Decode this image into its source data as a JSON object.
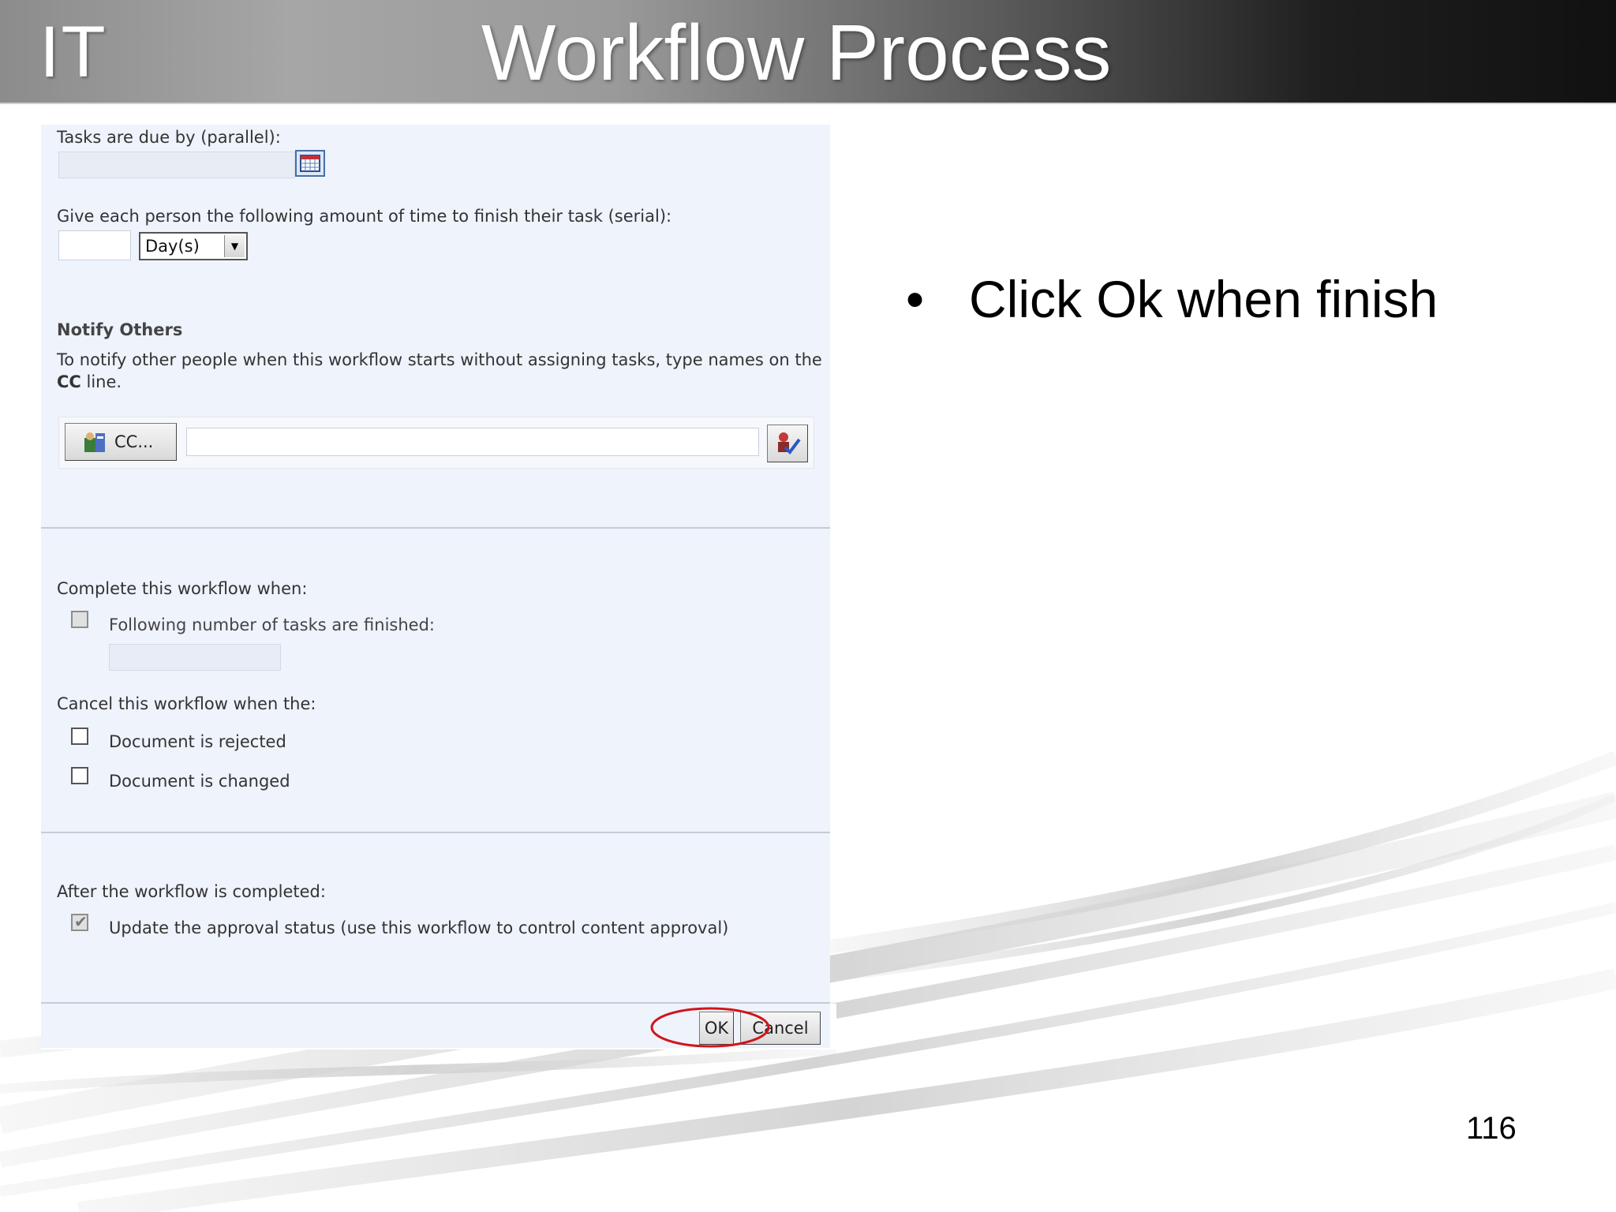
{
  "header": {
    "brand": "IT",
    "title": "Workflow Process"
  },
  "form": {
    "due_parallel_label": "Tasks are due by (parallel):",
    "due_parallel_value": "",
    "serial_time_label": "Give each person the following amount of time to finish their task (serial):",
    "serial_time_value": "",
    "serial_unit_selected": "Day(s)",
    "notify_heading": "Notify Others",
    "notify_description_line1": "To notify other people when this workflow starts without assigning tasks, type names on the",
    "notify_description_cc": "CC",
    "notify_description_line2_rest": " line.",
    "cc_button_label": "CC...",
    "cc_value": "",
    "complete_label": "Complete this workflow when:",
    "complete_option": "Following number of tasks are finished:",
    "complete_option_checked": false,
    "complete_count_value": "",
    "cancel_label": "Cancel this workflow when the:",
    "cancel_options": [
      {
        "label": "Document is rejected",
        "checked": false
      },
      {
        "label": "Document is changed",
        "checked": false
      }
    ],
    "after_label": "After the workflow is completed:",
    "after_option": "Update the approval status (use this workflow to control content approval)",
    "after_option_checked": true,
    "ok_label": "OK",
    "cancel_button_label": "Cancel"
  },
  "bullets": [
    {
      "marker": "•",
      "text": "Click Ok when finish"
    }
  ],
  "page_number": "116",
  "colors": {
    "panel_background": "#eef3fc",
    "highlight_ellipse": "#d0151c"
  }
}
